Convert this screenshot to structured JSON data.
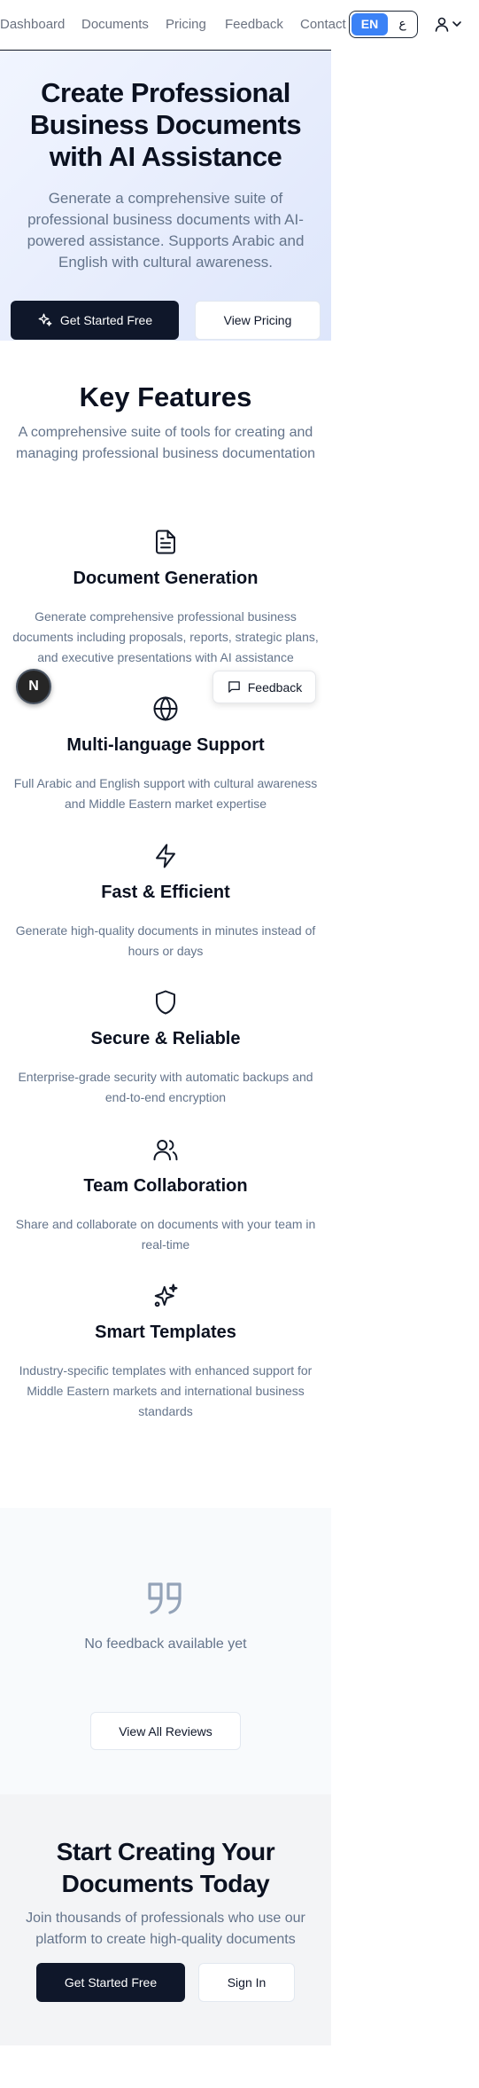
{
  "nav": {
    "links": [
      "Dashboard",
      "Documents",
      "Pricing",
      "Feedback",
      "Contact"
    ],
    "lang_en": "EN",
    "lang_ar": "ع"
  },
  "hero": {
    "title": "Create Professional Business Documents with AI Assistance",
    "subtitle": "Generate a comprehensive suite of professional business documents with AI-powered assistance. Supports Arabic and English with cultural awareness.",
    "primary_button": "Get Started Free",
    "secondary_button": "View Pricing"
  },
  "features": {
    "title": "Key Features",
    "subtitle": "A comprehensive suite of tools for creating and managing professional business documentation",
    "items": [
      {
        "icon": "document-icon",
        "title": "Document Generation",
        "description": "Generate comprehensive professional business documents including proposals, reports, strategic plans, and executive presentations with AI assistance"
      },
      {
        "icon": "globe-icon",
        "title": "Multi-language Support",
        "description": "Full Arabic and English support with cultural awareness and Middle Eastern market expertise"
      },
      {
        "icon": "lightning-icon",
        "title": "Fast & Efficient",
        "description": "Generate high-quality documents in minutes instead of hours or days"
      },
      {
        "icon": "shield-icon",
        "title": "Secure & Reliable",
        "description": "Enterprise-grade security with automatic backups and end-to-end encryption"
      },
      {
        "icon": "users-icon",
        "title": "Team Collaboration",
        "description": "Share and collaborate on documents with your team in real-time"
      },
      {
        "icon": "sparkles-icon",
        "title": "Smart Templates",
        "description": "Industry-specific templates with enhanced support for Middle Eastern markets and international business standards"
      }
    ]
  },
  "floating": {
    "dev_badge": "N",
    "feedback_label": "Feedback"
  },
  "testimonials": {
    "empty_text": "No feedback available yet",
    "view_all_button": "View All Reviews"
  },
  "cta": {
    "title": "Start Creating Your Documents Today",
    "subtitle": "Join thousands of professionals who use our platform to create high-quality documents",
    "primary_button": "Get Started Free",
    "secondary_button": "Sign In"
  },
  "colors": {
    "primary": "#0f172a",
    "accent": "#3b82f6",
    "muted_text": "#64748b"
  }
}
